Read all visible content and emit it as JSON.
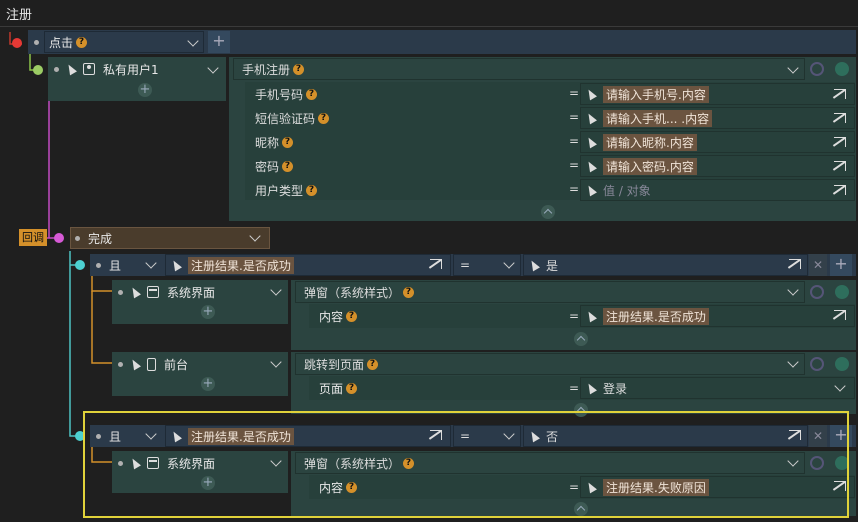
{
  "title": "注册",
  "callback_tag": "回调",
  "event": {
    "label": "点击"
  },
  "user": {
    "label": "私有用户1"
  },
  "action1": {
    "label": "手机注册",
    "params": [
      {
        "name": "手机号码",
        "value": "请输入手机号.内容"
      },
      {
        "name": "短信验证码",
        "value": "请输入手机... .内容"
      },
      {
        "name": "昵称",
        "value": "请输入昵称.内容"
      },
      {
        "name": "密码",
        "value": "请输入密码.内容"
      },
      {
        "name": "用户类型",
        "placeholder": "值 / 对象"
      }
    ]
  },
  "done": {
    "label": "完成"
  },
  "cond1": {
    "op": "且",
    "left": "注册结果.是否成功",
    "eq": "=",
    "right": "是"
  },
  "sys1": {
    "label": "系统界面",
    "action": "弹窗（系统样式）",
    "param": "内容",
    "value": "注册结果.是否成功"
  },
  "fg": {
    "label": "前台",
    "action": "跳转到页面",
    "param": "页面",
    "value": "登录"
  },
  "cond2": {
    "op": "且",
    "left": "注册结果.是否成功",
    "eq": "=",
    "right": "否"
  },
  "sys2": {
    "label": "系统界面",
    "action": "弹窗（系统样式）",
    "param": "内容",
    "value": "注册结果.失败原因"
  },
  "colors": {
    "navy": "#2b3a4a",
    "teal": "#2b4440",
    "highlight": "#6b5440",
    "accent": "#d4902a",
    "selection": "#e0d23a"
  }
}
